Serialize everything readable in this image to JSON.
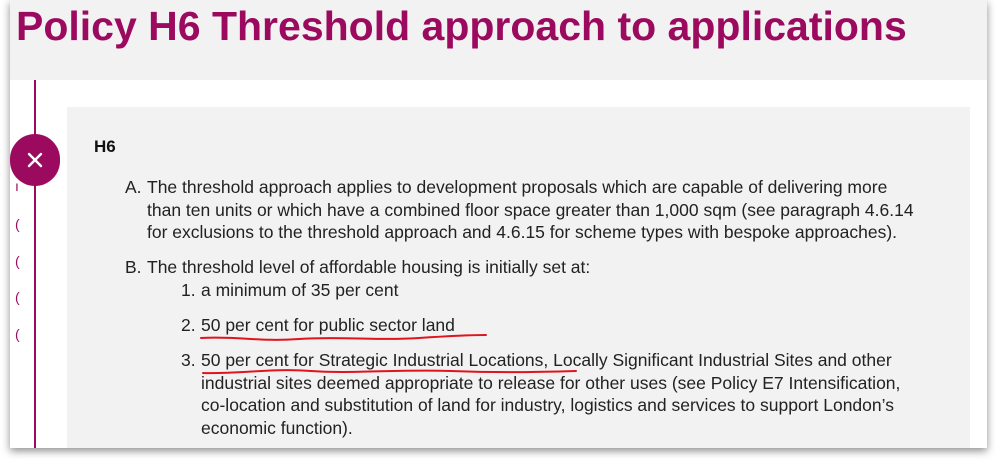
{
  "title": "Policy H6 Threshold approach to applications",
  "close_icon": "close-icon",
  "side_marks": [
    "ı",
    "(",
    "(",
    "(",
    "("
  ],
  "policy": {
    "code": "H6",
    "items": [
      {
        "marker": "A.",
        "lines": [
          "The threshold approach applies to development proposals which are capable of delivering more",
          "than ten units or which have a combined floor space greater than 1,000 sqm (see paragraph 4.6.14",
          "for exclusions to the threshold approach and 4.6.15 for scheme types with bespoke approaches)."
        ]
      },
      {
        "marker": "B.",
        "lines": [
          "The threshold level of affordable housing is initially set at:"
        ],
        "subitems": [
          {
            "marker": "1.",
            "lines": [
              "a minimum of 35 per cent"
            ]
          },
          {
            "marker": "2.",
            "lines": [
              "50 per cent for public sector land"
            ]
          },
          {
            "marker": "3.",
            "first_underlined": "50 per cent for Strategic Industrial Locations,",
            "first_rest": " Locally Significant Industrial Sites and other",
            "lines": [
              "industrial sites deemed appropriate to release for other uses (see Policy E7 Intensification,",
              "co-location and substitution of land for industry, logistics and services to support London’s",
              "economic function)."
            ]
          }
        ]
      }
    ]
  },
  "colors": {
    "accent": "#9b0a5e",
    "annotation": "#e0141e",
    "panel_bg": "#f2f2f2"
  }
}
